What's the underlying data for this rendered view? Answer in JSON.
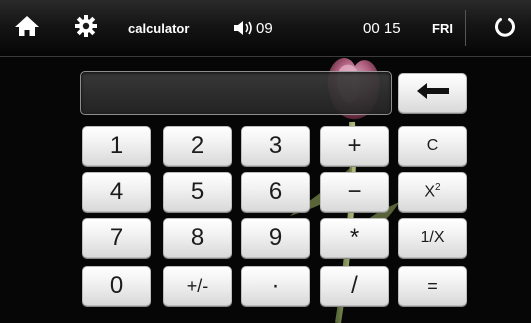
{
  "status_bar": {
    "title": "calculator",
    "volume": "09",
    "time": "00 15",
    "day": "FRI",
    "icons": {
      "home": "home-icon",
      "settings": "gear-icon",
      "volume": "speaker-icon",
      "power": "power-icon"
    }
  },
  "display": {
    "value": ""
  },
  "keypad": {
    "row1": [
      "1",
      "2",
      "3",
      "+",
      "C"
    ],
    "row2": [
      "4",
      "5",
      "6",
      "−",
      "X"
    ],
    "row2_superscript": "2",
    "row3": [
      "7",
      "8",
      "9",
      "*",
      "1/X"
    ],
    "row4": [
      "0",
      "+/-",
      "·",
      "/",
      "="
    ],
    "backspace_icon": "backspace-arrow-icon"
  },
  "colors": {
    "background": "#060606",
    "key_face": "#f2f2f2",
    "key_text": "#1c1c1c",
    "status_text": "#ffffff"
  }
}
